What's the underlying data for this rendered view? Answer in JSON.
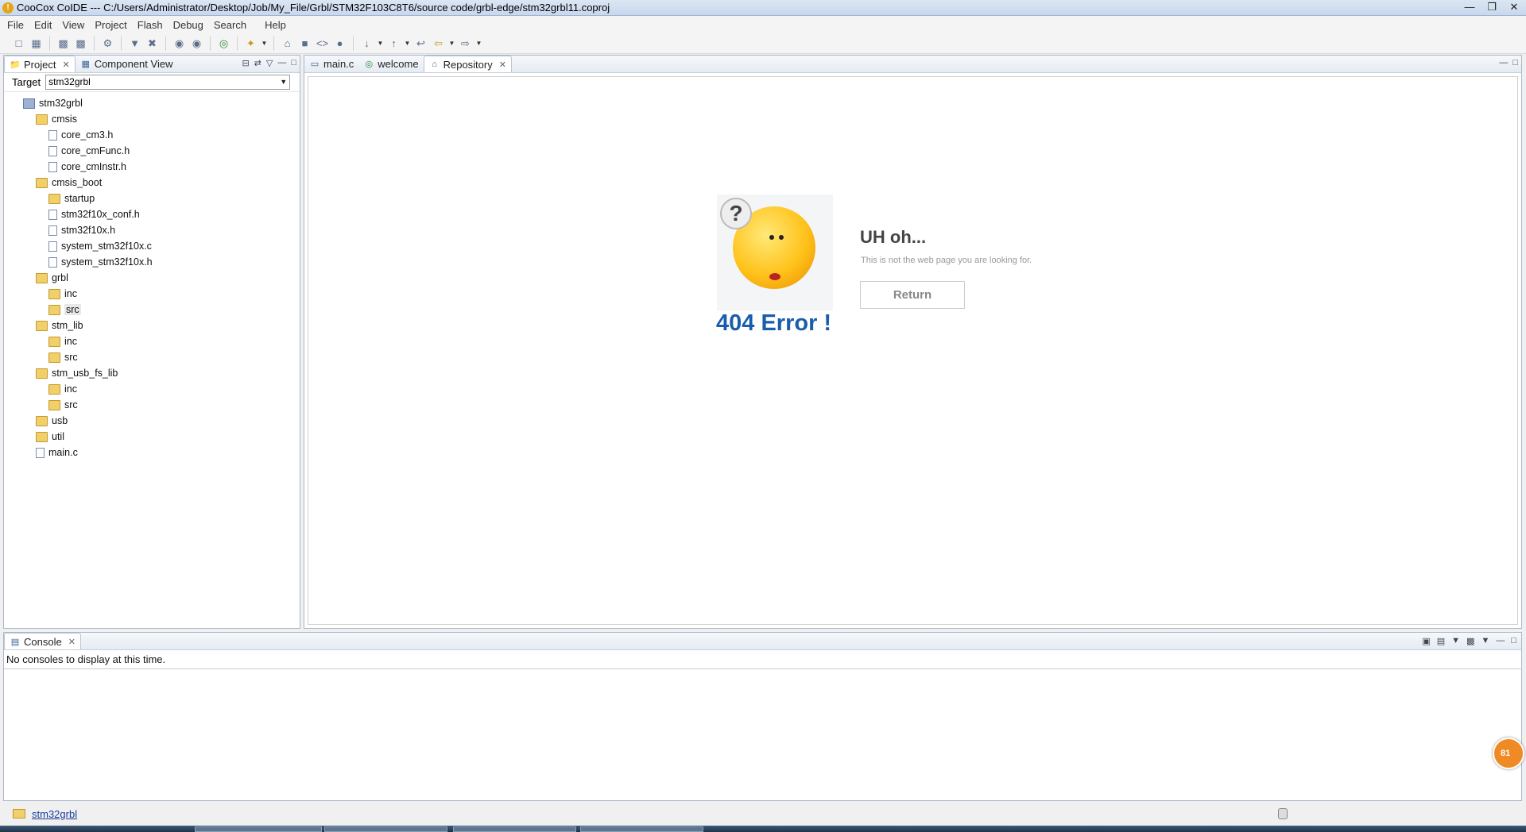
{
  "window": {
    "title": "CooCox CoIDE --- C:/Users/Administrator/Desktop/Job/My_File/Grbl/STM32F103C8T6/source code/grbl-edge/stm32grbl11.coproj",
    "app_icon": "!"
  },
  "menubar": {
    "items": [
      "File",
      "Edit",
      "View",
      "Project",
      "Flash",
      "Debug",
      "Search",
      "Help"
    ]
  },
  "left_panel": {
    "tabs": [
      {
        "label": "Project",
        "icon": "project-icon"
      },
      {
        "label": "Component View",
        "icon": "component-view-icon"
      }
    ],
    "target_label": "Target",
    "target_value": "stm32grbl",
    "tree": [
      {
        "label": "stm32grbl",
        "depth": 0,
        "kind": "project"
      },
      {
        "label": "cmsis",
        "depth": 1,
        "kind": "folder"
      },
      {
        "label": "core_cm3.h",
        "depth": 2,
        "kind": "file"
      },
      {
        "label": "core_cmFunc.h",
        "depth": 2,
        "kind": "file"
      },
      {
        "label": "core_cmInstr.h",
        "depth": 2,
        "kind": "file"
      },
      {
        "label": "cmsis_boot",
        "depth": 1,
        "kind": "folder"
      },
      {
        "label": "startup",
        "depth": 2,
        "kind": "folder"
      },
      {
        "label": "stm32f10x_conf.h",
        "depth": 2,
        "kind": "file"
      },
      {
        "label": "stm32f10x.h",
        "depth": 2,
        "kind": "file"
      },
      {
        "label": "system_stm32f10x.c",
        "depth": 2,
        "kind": "file"
      },
      {
        "label": "system_stm32f10x.h",
        "depth": 2,
        "kind": "file"
      },
      {
        "label": "grbl",
        "depth": 1,
        "kind": "folder"
      },
      {
        "label": "inc",
        "depth": 2,
        "kind": "folder"
      },
      {
        "label": "src",
        "depth": 2,
        "kind": "folder",
        "selected": true
      },
      {
        "label": "stm_lib",
        "depth": 1,
        "kind": "folder"
      },
      {
        "label": "inc",
        "depth": 2,
        "kind": "folder"
      },
      {
        "label": "src",
        "depth": 2,
        "kind": "folder"
      },
      {
        "label": "stm_usb_fs_lib",
        "depth": 1,
        "kind": "folder"
      },
      {
        "label": "inc",
        "depth": 2,
        "kind": "folder"
      },
      {
        "label": "src",
        "depth": 2,
        "kind": "folder"
      },
      {
        "label": "usb",
        "depth": 1,
        "kind": "folder"
      },
      {
        "label": "util",
        "depth": 1,
        "kind": "folder"
      },
      {
        "label": "main.c",
        "depth": 1,
        "kind": "file"
      }
    ]
  },
  "editor": {
    "tabs": [
      {
        "label": "main.c",
        "icon": "c-file-icon"
      },
      {
        "label": "welcome",
        "icon": "globe-icon"
      },
      {
        "label": "Repository",
        "icon": "home-icon"
      }
    ],
    "error_page": {
      "image_caption": "404 Error !",
      "bubble_text": "?",
      "heading": "UH oh...",
      "subtext": "This is not the web page you are looking for.",
      "button_label": "Return"
    }
  },
  "console": {
    "tab_label": "Console",
    "message": "No consoles to display at this time.",
    "badge": "81"
  },
  "statusbar": {
    "project_link": "stm32grbl"
  }
}
